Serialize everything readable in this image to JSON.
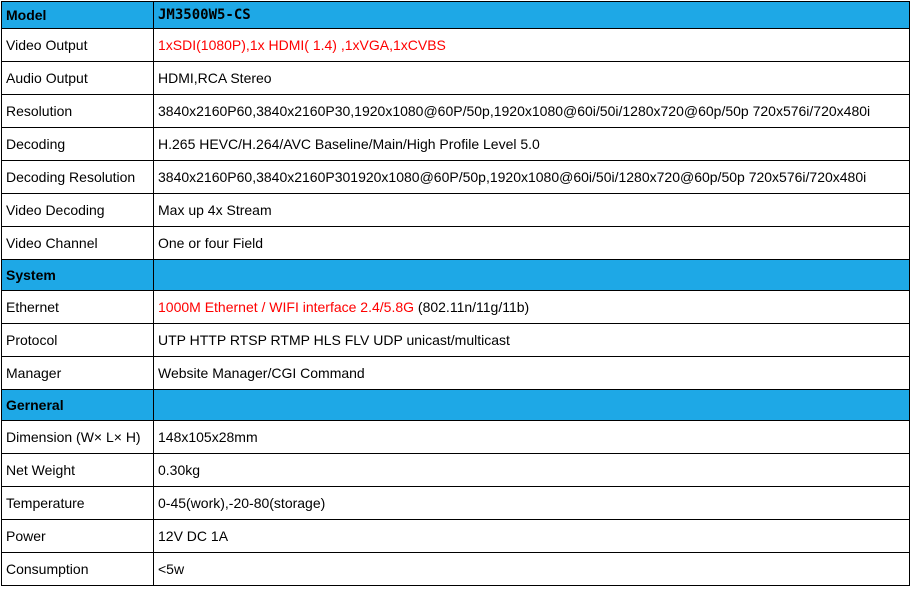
{
  "header": {
    "label": "Model",
    "value": "JM3500W5-CS"
  },
  "video_output": {
    "label": "Video Output",
    "value": "1xSDI(1080P),1x HDMI( 1.4) ,1xVGA,1xCVBS"
  },
  "audio_output": {
    "label": "Audio Output",
    "value": "HDMI,RCA Stereo"
  },
  "resolution": {
    "label": "Resolution",
    "value": "3840x2160P60,3840x2160P30,1920x1080@60P/50p,1920x1080@60i/50i/1280x720@60p/50p 720x576i/720x480i"
  },
  "decoding": {
    "label": "Decoding",
    "value": "H.265 HEVC/H.264/AVC Baseline/Main/High Profile Level 5.0"
  },
  "decoding_resolution": {
    "label": "Decoding Resolution",
    "value": "3840x2160P60,3840x2160P301920x1080@60P/50p,1920x1080@60i/50i/1280x720@60p/50p 720x576i/720x480i"
  },
  "video_decoding": {
    "label": "Video Decoding",
    "value": "Max up 4x Stream"
  },
  "video_channel": {
    "label": "Video Channel",
    "value": "One or four Field"
  },
  "system": {
    "label": "System"
  },
  "ethernet": {
    "label": "Ethernet",
    "value_red": "1000M Ethernet / WIFI interface 2.4/5.8G",
    "value_rest": " (802.11n/11g/11b)"
  },
  "protocol": {
    "label": "Protocol",
    "value": "UTP HTTP RTSP RTMP HLS FLV UDP unicast/multicast"
  },
  "manager": {
    "label": "Manager",
    "value": "Website Manager/CGI Command"
  },
  "general": {
    "label": "Gerneral"
  },
  "dimension": {
    "label": "Dimension (W× L× H)",
    "value": "148x105x28mm"
  },
  "net_weight": {
    "label": "Net Weight",
    "value": "0.30kg"
  },
  "temperature": {
    "label": "Temperature",
    "value": "0-45(work),-20-80(storage)"
  },
  "power": {
    "label": "Power",
    "value": "12V DC 1A"
  },
  "consumption": {
    "label": "Consumption",
    "value": "<5w"
  },
  "colors": {
    "section_bg": "#1ea8e6",
    "highlight_text": "#ff0000"
  }
}
